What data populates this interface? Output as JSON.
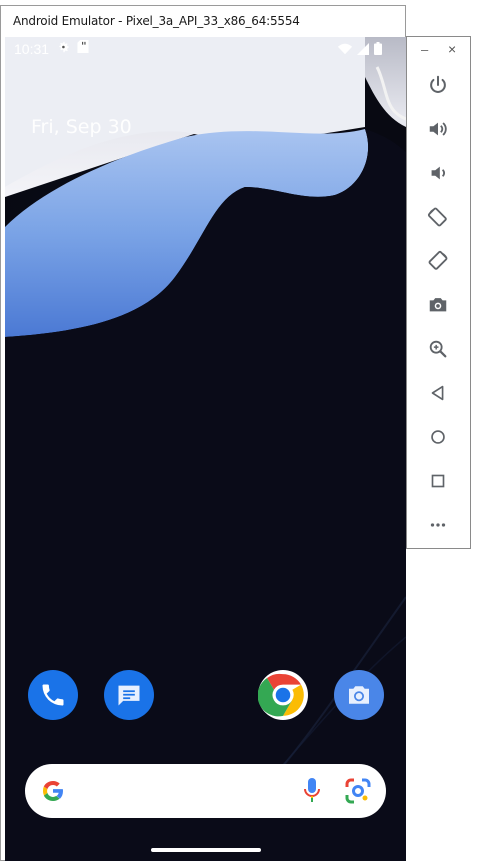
{
  "window": {
    "title": "Android Emulator - Pixel_3a_API_33_x86_64:5554"
  },
  "status_bar": {
    "time": "10:31",
    "left_icons": [
      "settings-gear-icon",
      "sd-card-icon"
    ],
    "right_icons": [
      "wifi-icon",
      "cell-signal-icon",
      "battery-icon"
    ]
  },
  "home": {
    "date": "Fri, Sep 30",
    "dock": [
      {
        "name": "phone",
        "color": "#1a73e8"
      },
      {
        "name": "messages",
        "color": "#1a73e8"
      },
      {
        "name": "chrome",
        "color": "#ffffff"
      },
      {
        "name": "camera",
        "color": "#4a86e8"
      }
    ],
    "search_bar": {
      "icons": [
        "google-g-icon",
        "mic-icon",
        "lens-icon"
      ]
    }
  },
  "toolbar": {
    "window_controls": {
      "minimize": "–",
      "close": "×"
    },
    "buttons": [
      {
        "name": "power",
        "icon": "power-icon"
      },
      {
        "name": "volume-up",
        "icon": "volume-up-icon"
      },
      {
        "name": "volume-down",
        "icon": "volume-down-icon"
      },
      {
        "name": "rotate-left",
        "icon": "rotate-left-icon"
      },
      {
        "name": "rotate-right",
        "icon": "rotate-right-icon"
      },
      {
        "name": "screenshot",
        "icon": "camera-icon"
      },
      {
        "name": "zoom",
        "icon": "zoom-in-icon"
      },
      {
        "name": "back",
        "icon": "back-triangle-icon"
      },
      {
        "name": "home",
        "icon": "home-circle-icon"
      },
      {
        "name": "overview",
        "icon": "overview-square-icon"
      },
      {
        "name": "more",
        "icon": "more-dots-icon"
      }
    ],
    "icon_color": "#5f6368"
  }
}
